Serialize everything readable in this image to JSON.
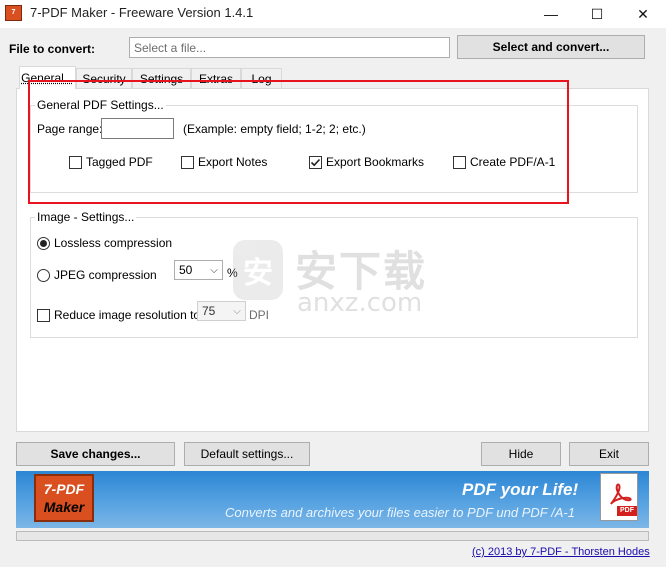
{
  "window": {
    "title": "7-PDF Maker - Freeware Version 1.4.1",
    "minimize_glyph": "—",
    "maximize_glyph": "☐",
    "close_glyph": "✕"
  },
  "file_row": {
    "label": "File to convert:",
    "placeholder": "Select a file...",
    "select_button": "Select and convert..."
  },
  "tabs": [
    {
      "label": "General...",
      "active": true
    },
    {
      "label": "Security"
    },
    {
      "label": "Settings"
    },
    {
      "label": "Extras"
    },
    {
      "label": "Log"
    }
  ],
  "general_settings": {
    "group_title": "General PDF Settings...",
    "page_range_label": "Page range:",
    "page_range_value": "",
    "page_range_hint": "(Example: empty field; 1-2; 2; etc.)",
    "checkboxes": [
      {
        "label": "Tagged PDF",
        "checked": false
      },
      {
        "label": "Export Notes",
        "checked": false
      },
      {
        "label": "Export Bookmarks",
        "checked": true
      },
      {
        "label": "Create PDF/A-1",
        "checked": false
      }
    ]
  },
  "image_settings": {
    "group_title": "Image - Settings...",
    "lossless_label": "Lossless compression",
    "lossless_selected": true,
    "jpeg_label": "JPEG compression",
    "jpeg_quality": "50",
    "jpeg_unit": "%",
    "reduce_label": "Reduce image resolution to",
    "reduce_checked": false,
    "dpi_value": "75",
    "dpi_unit": "DPI"
  },
  "watermark": {
    "cn": "安下载",
    "en": "anxz.com",
    "logo_glyph": "安"
  },
  "buttons": {
    "save": "Save changes...",
    "defaults": "Default settings...",
    "hide": "Hide",
    "exit": "Exit"
  },
  "banner": {
    "logo_line1": "7-PDF",
    "logo_line2": "Maker",
    "slogan": "PDF your Life!",
    "subtitle": "Converts and archives your files easier to PDF und PDF /A-1",
    "pdf_badge": "PDF"
  },
  "footer": {
    "copyright": "(c) 2013 by 7-PDF - Thorsten Hodes"
  },
  "colors": {
    "annotation_red": "#e8131d",
    "banner_blue": "#2c86d4",
    "brand_orange": "#d94f1f",
    "link_blue": "#1a0dab"
  },
  "arrow_glyph": "⌵"
}
